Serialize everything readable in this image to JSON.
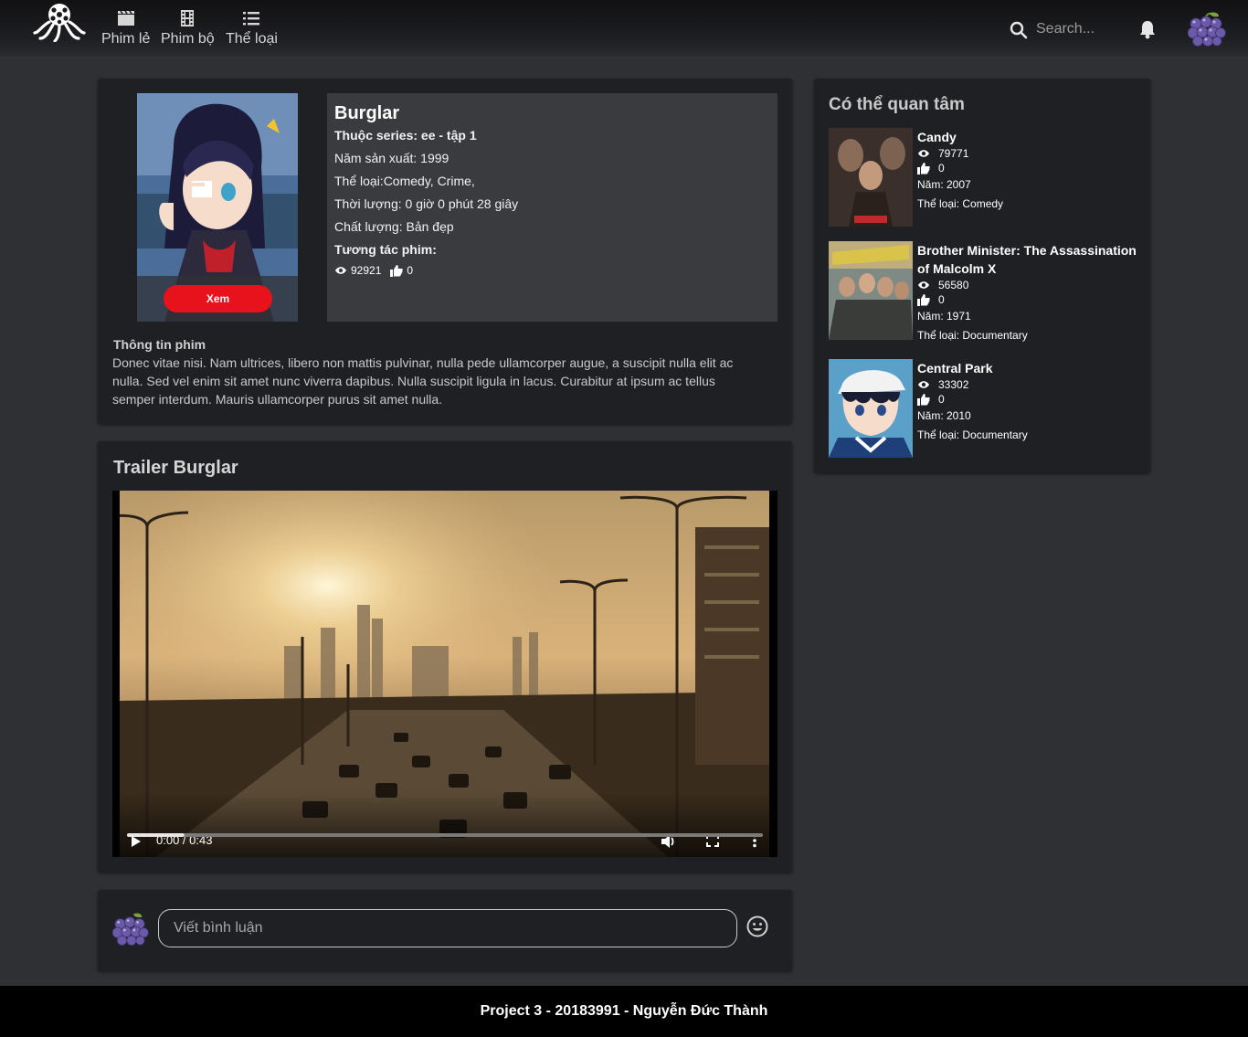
{
  "nav": {
    "items": [
      {
        "label": "Phim lẻ",
        "icon": "film-icon"
      },
      {
        "label": "Phim bộ",
        "icon": "film-strip-icon"
      },
      {
        "label": "Thể loại",
        "icon": "list-icon"
      }
    ],
    "search_placeholder": "Search..."
  },
  "movie": {
    "title": "Burglar",
    "series": "Thuộc series: ee - tập 1",
    "year": "Năm sản xuất: 1999",
    "genre": "Thể loại:Comedy, Crime,",
    "duration": "Thời lượng: 0 giờ 0 phút 28 giây",
    "quality": "Chất lượng: Bản đẹp",
    "interaction_label": "Tương tác phim:",
    "views": "92921",
    "likes": "0",
    "watch_label": "Xem"
  },
  "description": {
    "title": "Thông tin phim",
    "text": "Donec vitae nisi. Nam ultrices, libero non mattis pulvinar, nulla pede ullamcorper augue, a suscipit nulla elit ac nulla. Sed vel enim sit amet nunc viverra dapibus. Nulla suscipit ligula in lacus. Curabitur at ipsum ac tellus semper interdum. Mauris ullamcorper purus sit amet nulla."
  },
  "trailer": {
    "title": "Trailer Burglar",
    "time": "0:00 / 0:43",
    "progress": 0.09
  },
  "comment": {
    "placeholder": "Viết bình luận"
  },
  "sidebar": {
    "title": "Có thể quan tâm",
    "items": [
      {
        "name": "Candy",
        "views": "79771",
        "likes": "0",
        "year": "Năm: 2007",
        "genre": "Thể loại: Comedy"
      },
      {
        "name": "Brother Minister: The Assassination of Malcolm X",
        "views": "56580",
        "likes": "0",
        "year": "Năm: 1971",
        "genre": "Thể loại: Documentary"
      },
      {
        "name": "Central Park",
        "views": "33302",
        "likes": "0",
        "year": "Năm: 2010",
        "genre": "Thể loại: Documentary"
      }
    ]
  },
  "footer": {
    "text": "Project 3 - 20183991 - Nguyễn Đức Thành"
  }
}
